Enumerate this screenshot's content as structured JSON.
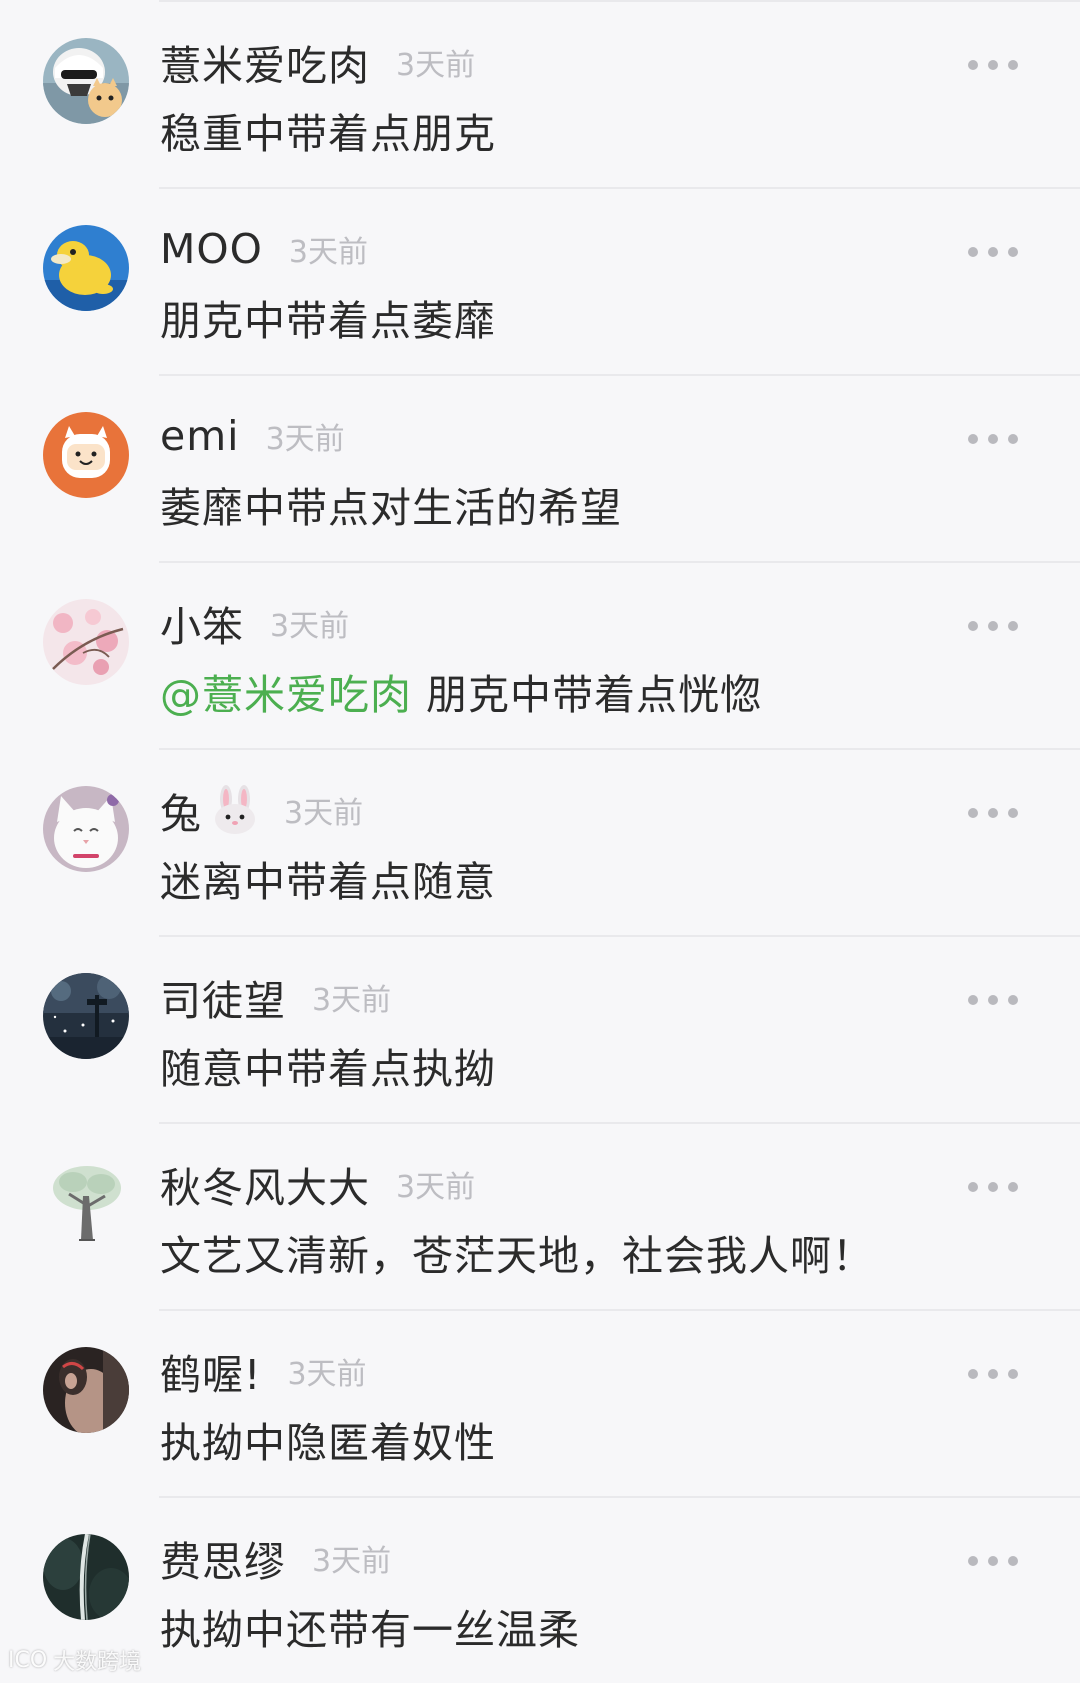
{
  "comments": [
    {
      "nickname": "薏米爱吃肉",
      "time": "3天前",
      "text": "稳重中带着点朋克",
      "avatar_icon": "stormtrooper-cat-avatar"
    },
    {
      "nickname": "MOO",
      "time": "3天前",
      "text": "朋克中带着点萎靡",
      "avatar_icon": "psyduck-avatar"
    },
    {
      "nickname": "emi",
      "time": "3天前",
      "text": "萎靡中带点对生活的希望",
      "avatar_icon": "finn-adventure-time-avatar"
    },
    {
      "nickname": "小笨",
      "time": "3天前",
      "mention": "@薏米爱吃肉",
      "text": " 朋克中带着点恍惚",
      "avatar_icon": "cherry-blossom-avatar"
    },
    {
      "nickname": "兔",
      "time": "3天前",
      "text": "迷离中带着点随意",
      "avatar_icon": "white-cat-avatar",
      "emoji": "rabbit-face-emoji"
    },
    {
      "nickname": "司徒望",
      "time": "3天前",
      "text": "随意中带着点执拗",
      "avatar_icon": "snowy-night-avatar"
    },
    {
      "nickname": "秋冬风大大",
      "time": "3天前",
      "text": "文艺又清新，苍茫天地，社会我人啊！",
      "avatar_icon": "tree-sketch-avatar"
    },
    {
      "nickname": "鹤喔!",
      "time": "3天前",
      "text": "执拗中隐匿着奴性",
      "avatar_icon": "portrait-photo-avatar"
    },
    {
      "nickname": "费思缪",
      "time": "3天前",
      "text": "执拗中还带有一丝温柔",
      "avatar_icon": "dark-road-avatar"
    }
  ],
  "watermark": {
    "logo": "ICO",
    "text": "大数跨境"
  },
  "colors": {
    "background": "#f7f7f9",
    "text": "#2b2b2b",
    "time": "#bdbdc2",
    "mention": "#4caf50",
    "divider": "#e9e9ec"
  }
}
